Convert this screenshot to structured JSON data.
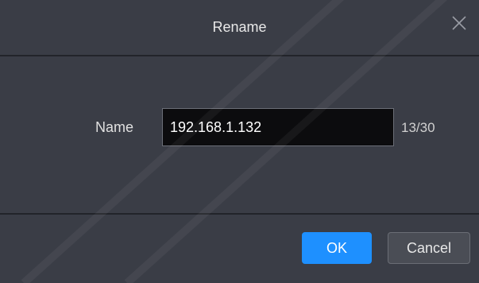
{
  "dialog": {
    "title": "Rename",
    "close_icon": "close-icon",
    "name_label": "Name",
    "name_value": "192.168.1.132",
    "char_counter": "13/30",
    "ok_label": "OK",
    "cancel_label": "Cancel"
  },
  "colors": {
    "background": "#3a3d46",
    "input_background": "#0c0c0e",
    "ok_button": "#1e90ff",
    "cancel_button": "#4a4d55"
  }
}
